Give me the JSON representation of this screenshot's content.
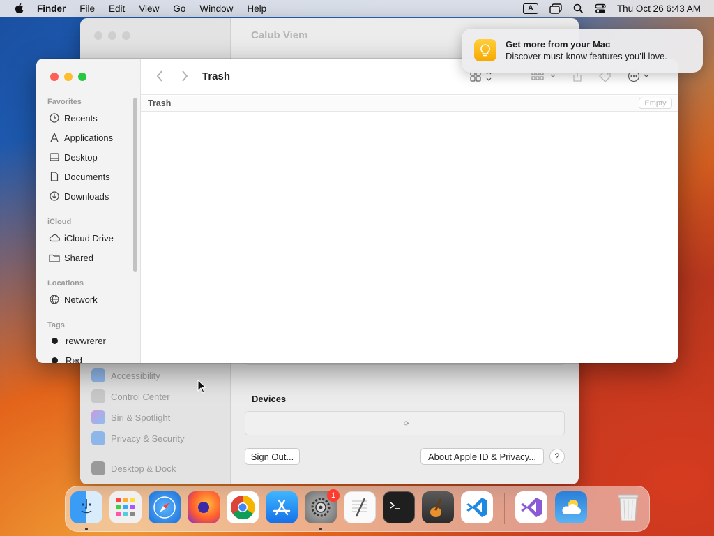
{
  "menubar": {
    "app_name": "Finder",
    "menus": [
      "File",
      "Edit",
      "View",
      "Go",
      "Window",
      "Help"
    ],
    "clock": "Thu Oct 26  6:43 AM",
    "input_source": "A"
  },
  "settings_window": {
    "title": "Calub Viem",
    "sidebar_items": [
      "Accessibility",
      "Control Center",
      "Siri & Spotlight",
      "Privacy & Security",
      "Desktop & Dock"
    ],
    "devices_heading": "Devices",
    "sign_out_label": "Sign Out...",
    "about_label": "About Apple ID & Privacy...",
    "help_label": "?"
  },
  "finder": {
    "title": "Trash",
    "path_title": "Trash",
    "empty_label": "Empty",
    "sections": {
      "favorites": "Favorites",
      "icloud": "iCloud",
      "locations": "Locations",
      "tags": "Tags"
    },
    "favorites": [
      "Recents",
      "Applications",
      "Desktop",
      "Documents",
      "Downloads"
    ],
    "icloud": [
      "iCloud Drive",
      "Shared"
    ],
    "locations": [
      "Network"
    ],
    "tags": [
      "rewwrerer",
      "Red"
    ]
  },
  "notification": {
    "title": "Get more from your Mac",
    "body": "Discover must-know features you’ll love."
  },
  "dock": {
    "apps": [
      "Finder",
      "Launchpad",
      "Safari",
      "Firefox",
      "Chrome",
      "App Store",
      "System Settings",
      "TextEdit",
      "Terminal",
      "GarageBand",
      "Visual Studio Code",
      "Visual Studio",
      "Weather",
      "Trash"
    ],
    "settings_badge": "1"
  },
  "colors": {
    "close": "#ff5f57",
    "minimize": "#febc2e",
    "zoom": "#28c840"
  }
}
